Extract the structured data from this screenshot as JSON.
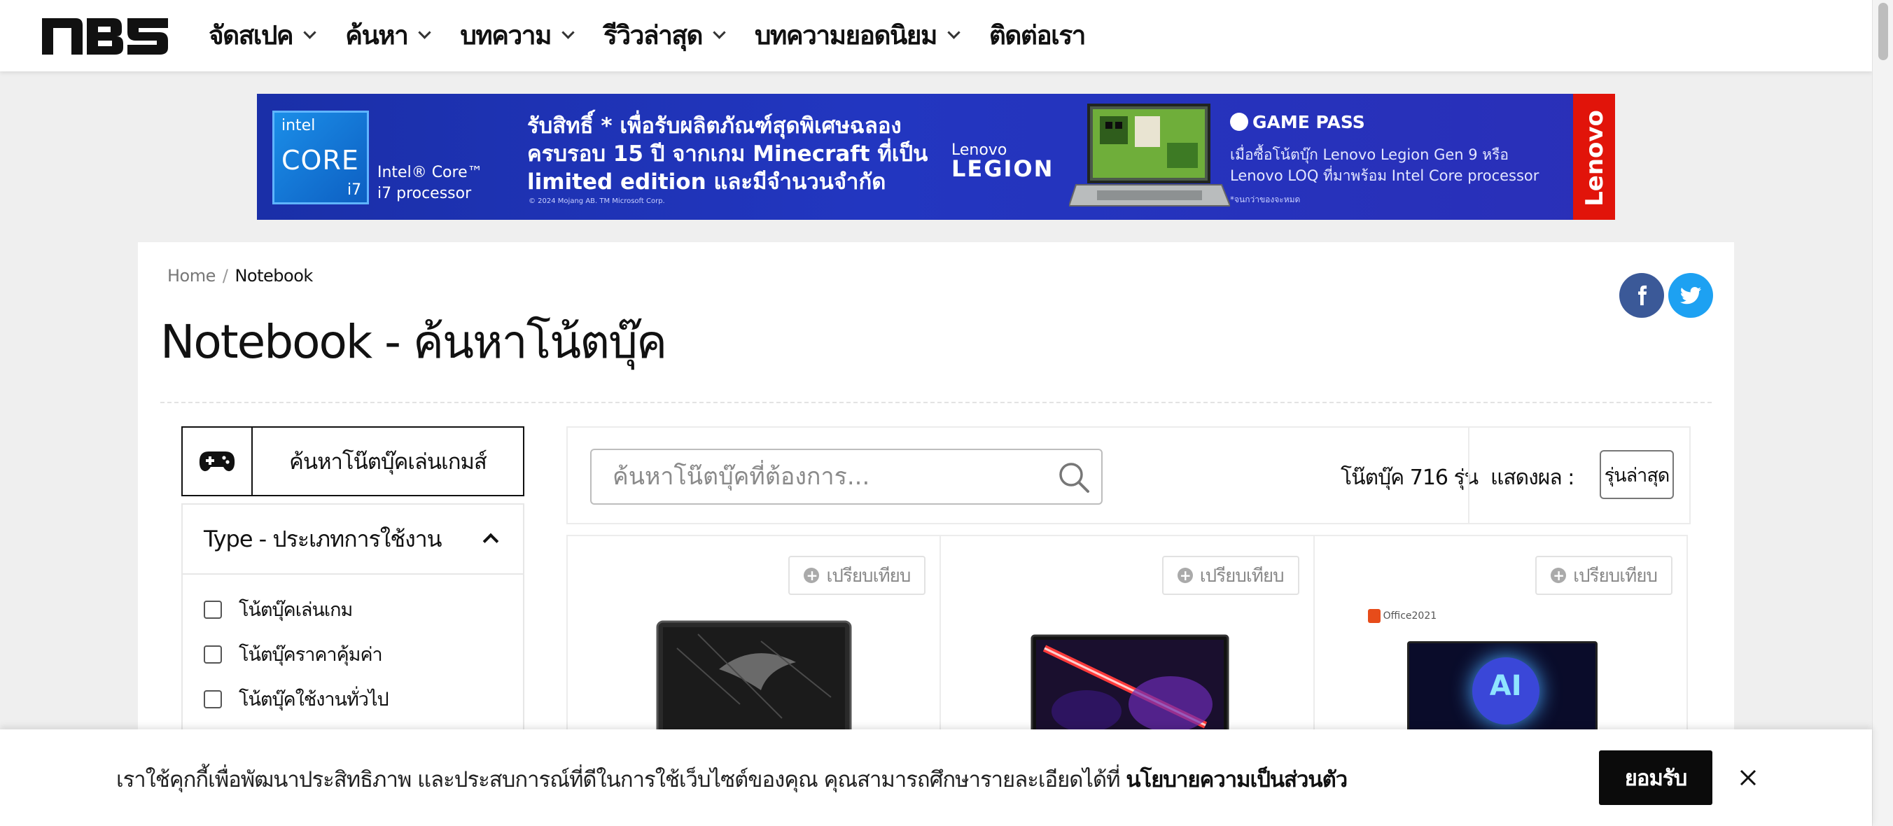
{
  "nav": {
    "logo_text": "nBS",
    "items": [
      {
        "label": "จัดสเปค",
        "has_dropdown": true
      },
      {
        "label": "ค้นหา",
        "has_dropdown": true
      },
      {
        "label": "บทความ",
        "has_dropdown": true
      },
      {
        "label": "รีวิวล่าสุด",
        "has_dropdown": true
      },
      {
        "label": "บทความยอดนิยม",
        "has_dropdown": true
      },
      {
        "label": "ติดต่อเรา",
        "has_dropdown": false
      }
    ]
  },
  "banner": {
    "intel_brand": "intel",
    "intel_core": "CORE",
    "intel_tier": "i7",
    "intel_processor": "Intel® Core™ i7 processor",
    "headline": "รับสิทธิ์ * เพื่อรับผลิตภัณฑ์สุดพิเศษฉลอง ครบรอบ 15 ปี จากเกม Minecraft ที่เป็น limited edition และมีจำนวนจำกัด",
    "legal": "© 2024 Mojang AB. TM Microsoft Corp.",
    "legion_top": "Lenovo",
    "legion_bottom": "LEGION",
    "gamepass": "GAME PASS",
    "gamepass_text": "เมื่อซื้อโน้ตบุ๊ก Lenovo Legion Gen 9 หรือ Lenovo LOQ ที่มาพร้อม Intel Core processor",
    "note": "*จนกว่าของจะหมด",
    "lenovo": "Lenovo",
    "colors": {
      "bg": "#2236c0",
      "side": "#e1140a"
    }
  },
  "breadcrumb": {
    "home": "Home",
    "sep": "/",
    "current": "Notebook"
  },
  "page_title": "Notebook - ค้นหาโน้ตบุ๊ค",
  "social": {
    "facebook_icon": "facebook-icon",
    "twitter_icon": "twitter-icon",
    "facebook_color": "#3b5998",
    "twitter_color": "#1da1f2"
  },
  "sidebar": {
    "game_search_label": "ค้นหาโน๊ตบุ๊คเล่นเกมส์",
    "type_filter_title": "Type - ประเภทการใช้งาน",
    "type_options": [
      "โน้ตบุ๊คเล่นเกม",
      "โน้ตบุ๊คราคาคุ้มค่า",
      "โน้ตบุ๊คใช้งานทั่วไป"
    ]
  },
  "search": {
    "placeholder": "ค้นหาโน๊ตบุ๊คที่ต้องการ...",
    "count_label": "โน๊ตบุ๊ค 716 รุ่น",
    "show_label": "แสดงผล :",
    "sort_value": "รุ่นล่าสุด"
  },
  "products": [
    {
      "compare_label": "เปรียบเทียบ"
    },
    {
      "compare_label": "เปรียบเทียบ"
    },
    {
      "compare_label": "เปรียบเทียบ",
      "badge": "Office2021",
      "screen_text": "AI"
    }
  ],
  "cookie": {
    "text": "เราใช้คุกกี้เพื่อพัฒนาประสิทธิภาพ และประสบการณ์ที่ดีในการใช้เว็บไซต์ของคุณ คุณสามารถศึกษารายละเอียดได้ที่ ",
    "link": "นโยบายความเป็นส่วนตัว",
    "accept": "ยอมรับ"
  }
}
